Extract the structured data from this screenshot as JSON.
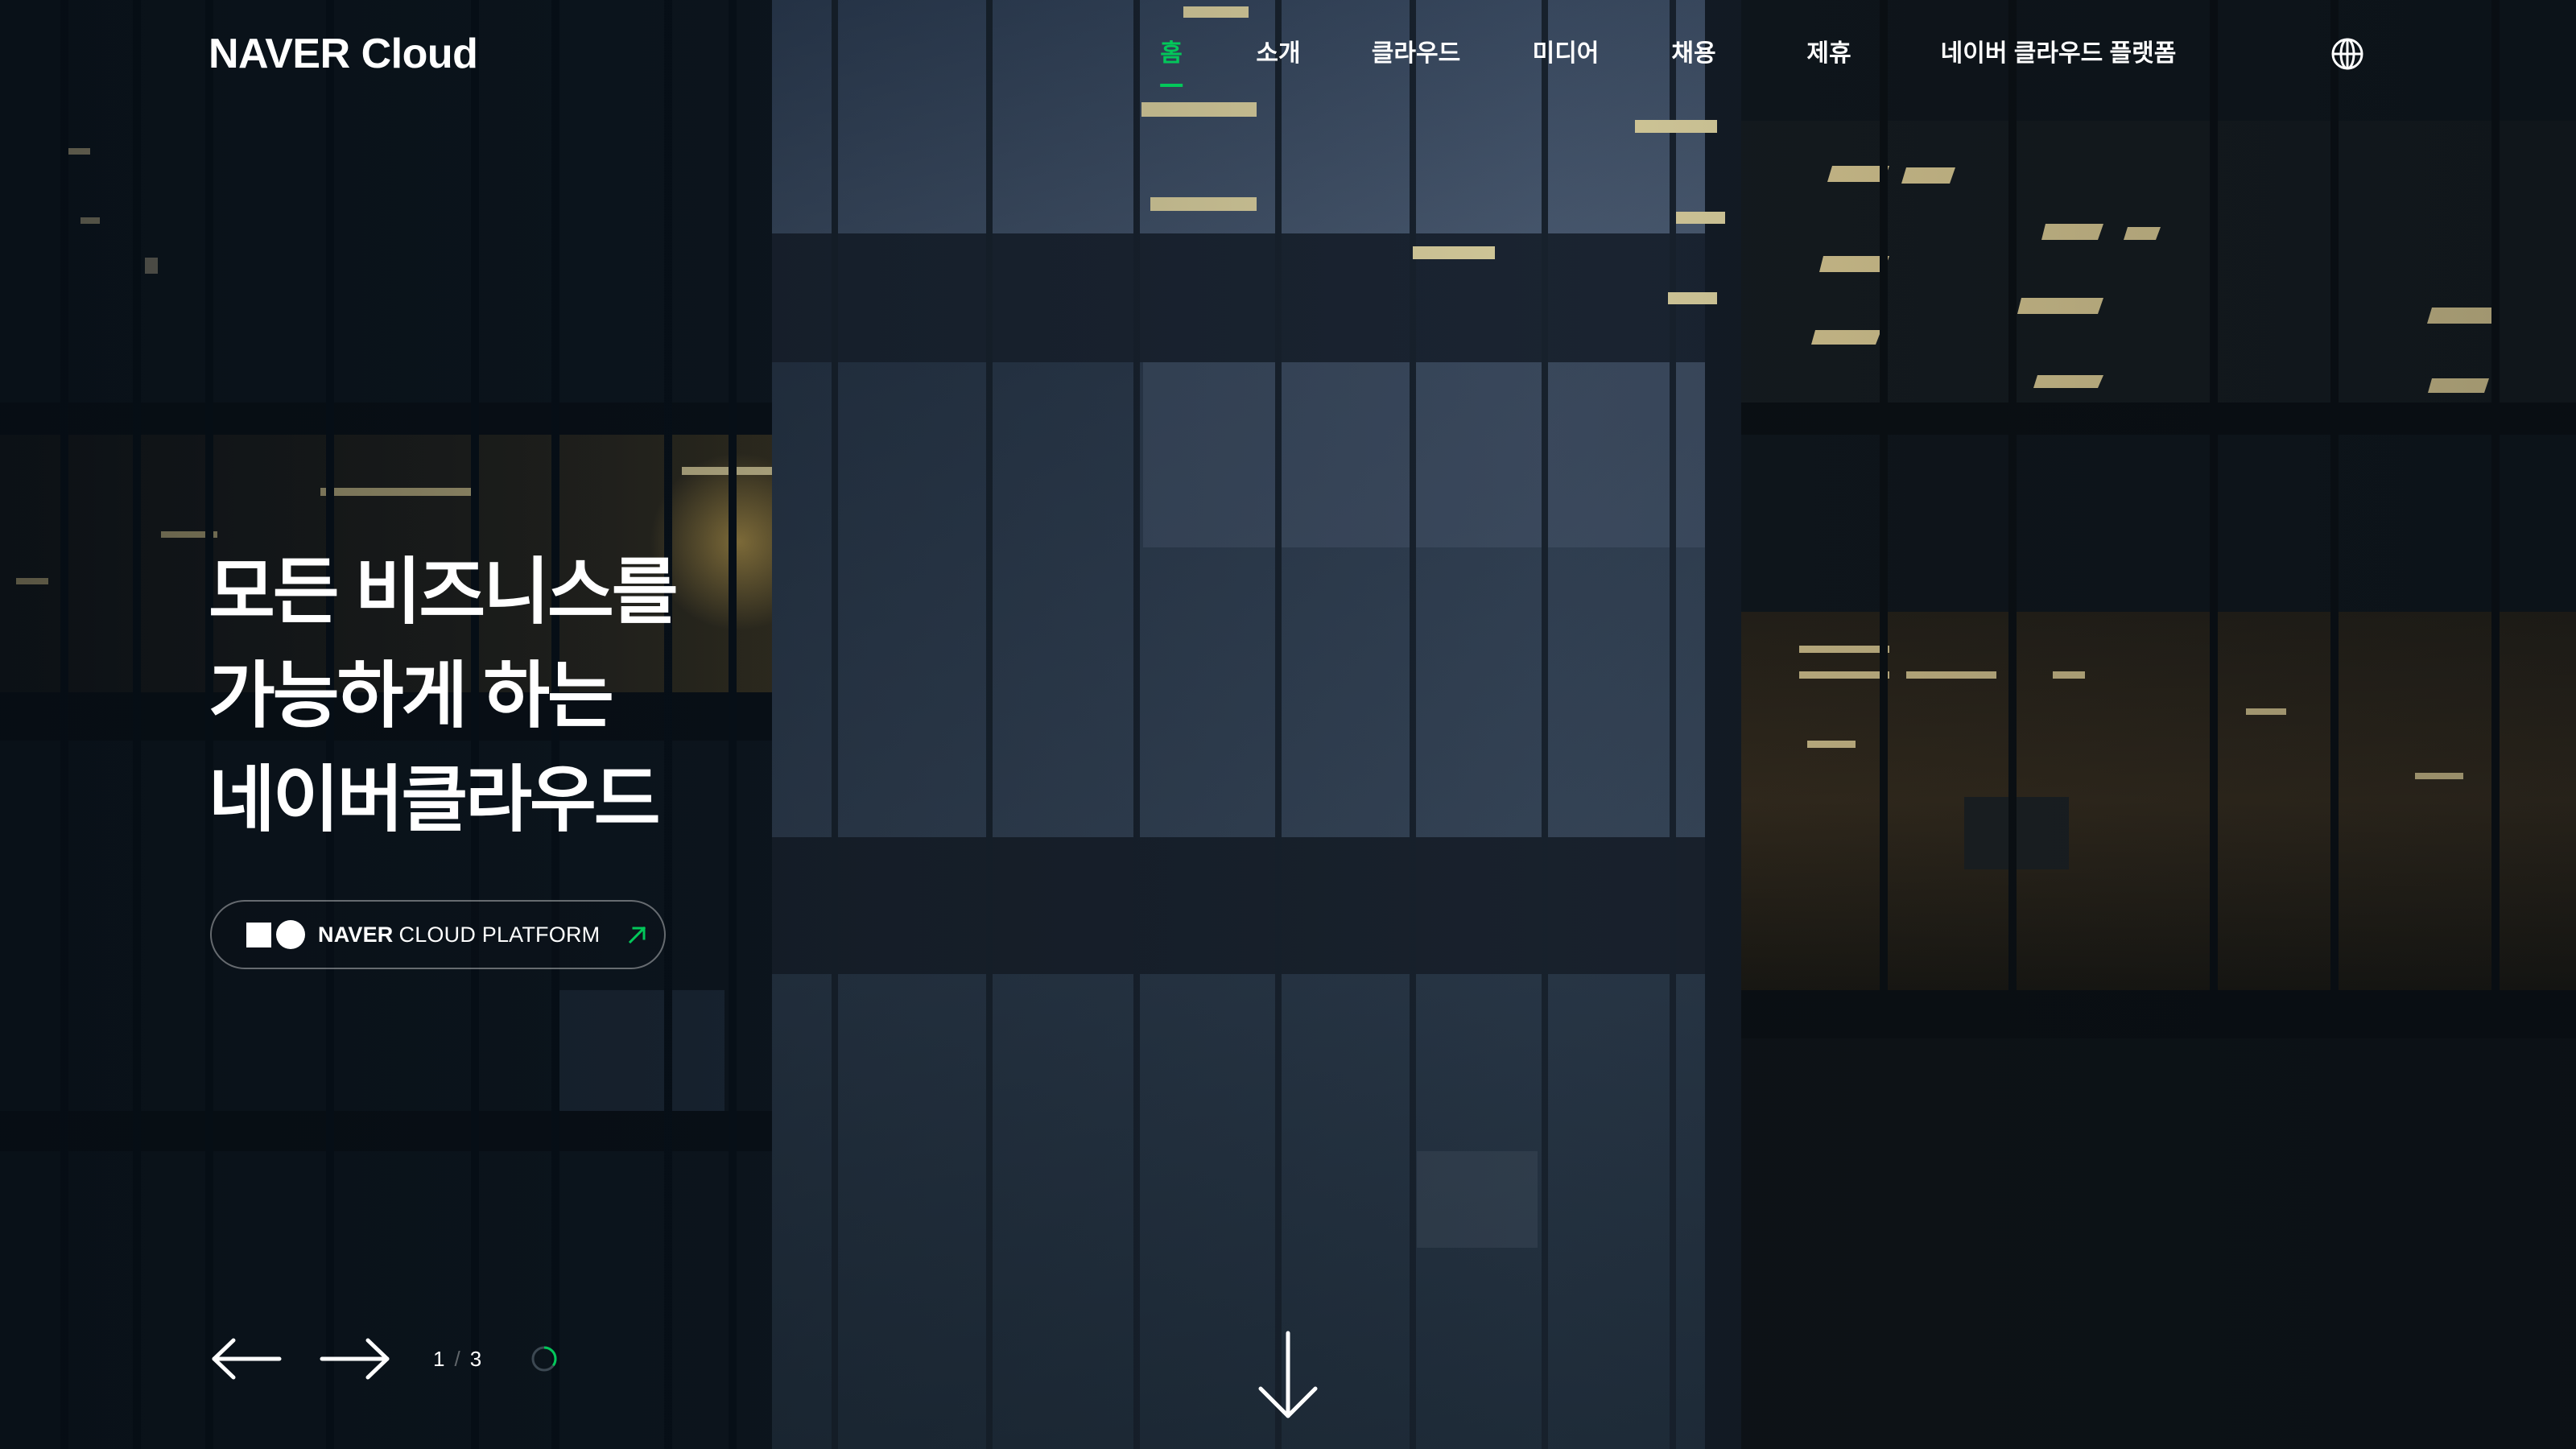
{
  "brand": {
    "logo_text": "NAVER Cloud"
  },
  "nav": {
    "items": [
      {
        "label": "홈",
        "active": true
      },
      {
        "label": "소개",
        "active": false
      },
      {
        "label": "클라우드",
        "active": false
      },
      {
        "label": "미디어",
        "active": false
      },
      {
        "label": "채용",
        "active": false
      },
      {
        "label": "제휴",
        "active": false
      },
      {
        "label": "네이버 클라우드 플랫폼",
        "active": false
      }
    ],
    "language_icon": "globe-icon"
  },
  "hero": {
    "headline_lines": [
      "모든 비즈니스를",
      "가능하게 하는",
      "네이버클라우드"
    ],
    "cta": {
      "label_bold": "NAVER",
      "label": "CLOUD PLATFORM",
      "logo_icon": "naver-cloud-platform-mark-icon",
      "arrow_icon": "arrow-up-right-icon"
    }
  },
  "slider": {
    "prev_icon": "arrow-left-icon",
    "next_icon": "arrow-right-icon",
    "current": "1",
    "separator": "/",
    "total": "3",
    "autoplay_icon": "progress-ring-icon",
    "autoplay_progress": 0.35
  },
  "scroll": {
    "icon": "arrow-down-icon"
  },
  "colors": {
    "accent": "#03c75a",
    "text": "#ffffff"
  }
}
